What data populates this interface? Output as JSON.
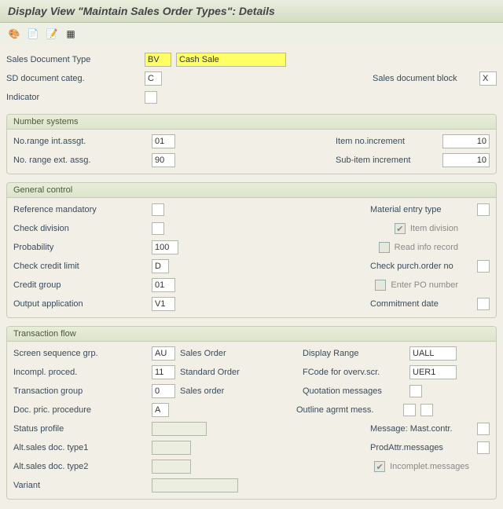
{
  "title": "Display View \"Maintain Sales Order Types\": Details",
  "toolbar": {
    "icons": [
      "magic",
      "page-nav",
      "page-add",
      "grid"
    ]
  },
  "header": {
    "salesDocType": {
      "label": "Sales Document Type",
      "code": "BV",
      "desc": "Cash Sale"
    },
    "sdDocCateg": {
      "label": "SD document categ.",
      "value": "C"
    },
    "salesDocBlock": {
      "label": "Sales document block",
      "value": "X"
    },
    "indicator": {
      "label": "Indicator"
    }
  },
  "numberSystems": {
    "title": "Number systems",
    "noRangeInt": {
      "label": "No.range int.assgt.",
      "value": "01"
    },
    "noRangeExt": {
      "label": "No. range ext. assg.",
      "value": "90"
    },
    "itemInc": {
      "label": "Item no.increment",
      "value": "10"
    },
    "subItemInc": {
      "label": "Sub-item increment",
      "value": "10"
    }
  },
  "generalControl": {
    "title": "General control",
    "refMandatory": {
      "label": "Reference mandatory"
    },
    "checkDivision": {
      "label": "Check division"
    },
    "probability": {
      "label": "Probability",
      "value": "100"
    },
    "checkCredit": {
      "label": "Check credit limit",
      "value": "D"
    },
    "creditGroup": {
      "label": "Credit group",
      "value": "01"
    },
    "outputApp": {
      "label": "Output application",
      "value": "V1"
    },
    "materialEntry": {
      "label": "Material entry type"
    },
    "itemDivision": {
      "label": "Item division",
      "checked": true
    },
    "readInfoRecord": {
      "label": "Read info record",
      "checked": false
    },
    "checkPurchOrder": {
      "label": "Check purch.order no"
    },
    "enterPONumber": {
      "label": "Enter PO number",
      "checked": false
    },
    "commitmentDate": {
      "label": "Commitment  date"
    }
  },
  "transactionFlow": {
    "title": "Transaction flow",
    "screenSeqGrp": {
      "label": "Screen sequence grp.",
      "value": "AU",
      "desc": "Sales Order"
    },
    "incomplProced": {
      "label": "Incompl. proced.",
      "value": "11",
      "desc": "Standard Order"
    },
    "transGroup": {
      "label": "Transaction group",
      "value": "0",
      "desc": "Sales order"
    },
    "docPricProc": {
      "label": "Doc. pric. procedure",
      "value": "A"
    },
    "statusProfile": {
      "label": "Status profile",
      "value": ""
    },
    "altType1": {
      "label": "Alt.sales doc. type1",
      "value": ""
    },
    "altType2": {
      "label": "Alt.sales doc. type2",
      "value": ""
    },
    "variant": {
      "label": "Variant",
      "value": ""
    },
    "displayRange": {
      "label": "Display Range",
      "value": "UALL"
    },
    "fcode": {
      "label": "FCode for overv.scr.",
      "value": "UER1"
    },
    "quotMsg": {
      "label": "Quotation messages"
    },
    "outlineAgrmt": {
      "label": "Outline agrmt mess."
    },
    "msgMastContr": {
      "label": "Message: Mast.contr."
    },
    "prodAttrMsg": {
      "label": "ProdAttr.messages"
    },
    "incomplMsg": {
      "label": "Incomplet.messages",
      "checked": true
    }
  }
}
